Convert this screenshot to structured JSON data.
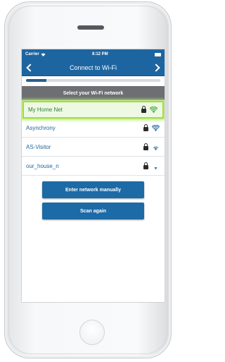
{
  "status_bar": {
    "carrier": "Carrier",
    "time": "8:12 PM",
    "wifi_icon": "wifi-icon",
    "battery_icon": "battery-icon"
  },
  "nav": {
    "title": "Connect to Wi-Fi",
    "back_icon": "chevron-left-icon",
    "forward_icon": "chevron-right-icon"
  },
  "progress": {
    "value": 0.15
  },
  "section_header": "Select your Wi-Fi network",
  "networks": [
    {
      "name": "My Home Net",
      "locked": true,
      "signal": 4,
      "selected": true
    },
    {
      "name": "Asynchrony",
      "locked": true,
      "signal": 4,
      "selected": false
    },
    {
      "name": "AS-Visitor",
      "locked": true,
      "signal": 2,
      "selected": false
    },
    {
      "name": "our_house_n",
      "locked": true,
      "signal": 1,
      "selected": false
    }
  ],
  "buttons": {
    "manual": "Enter network manually",
    "scan": "Scan again"
  },
  "colors": {
    "primary": "#1d65a1",
    "header_gray": "#6d6f73",
    "selected_green": "#9fde3f",
    "selected_text": "#2f7e3a",
    "wifi_green": "#3aa33a",
    "wifi_blue": "#1d65a1"
  }
}
